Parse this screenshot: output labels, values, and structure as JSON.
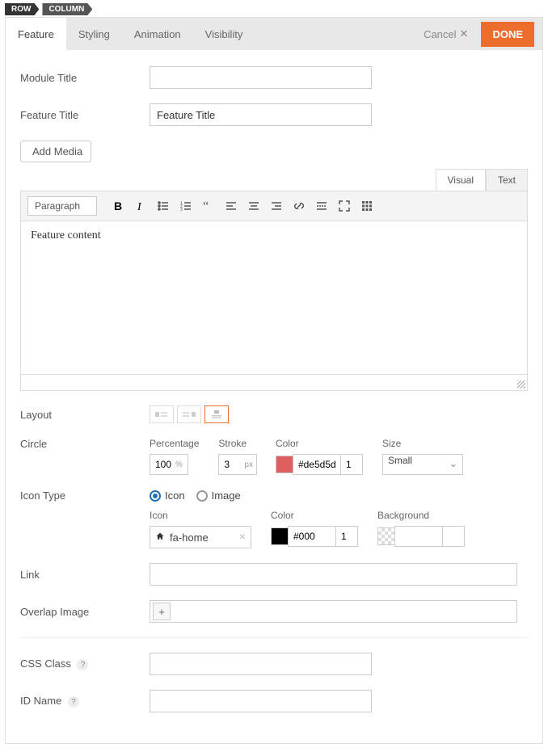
{
  "breadcrumb": {
    "row": "ROW",
    "column": "COLUMN"
  },
  "tabs": {
    "feature": "Feature",
    "styling": "Styling",
    "animation": "Animation",
    "visibility": "Visibility"
  },
  "actions": {
    "cancel": "Cancel",
    "done": "DONE"
  },
  "labels": {
    "module_title": "Module Title",
    "feature_title": "Feature Title",
    "add_media": "Add Media",
    "visual": "Visual",
    "text": "Text",
    "paragraph": "Paragraph",
    "layout": "Layout",
    "circle": "Circle",
    "percentage": "Percentage",
    "stroke": "Stroke",
    "color": "Color",
    "size": "Size",
    "icon_type": "Icon Type",
    "icon": "Icon",
    "image": "Image",
    "background": "Background",
    "link": "Link",
    "overlap_image": "Overlap Image",
    "css_class": "CSS Class",
    "id_name": "ID Name",
    "pct_unit": "%",
    "px_unit": "px"
  },
  "values": {
    "module_title": "",
    "feature_title": "Feature Title",
    "editor_content": "Feature content",
    "percentage": "100",
    "stroke": "3",
    "circle_color": "#de5d5d",
    "circle_opacity": "1",
    "size": "Small",
    "icon": "fa-home",
    "icon_color": "#000",
    "icon_opacity": "1",
    "bg_value": "",
    "link": "",
    "css_class": "",
    "id_name": ""
  },
  "colors": {
    "circle_swatch": "#de5d5d",
    "icon_swatch": "#000000"
  }
}
